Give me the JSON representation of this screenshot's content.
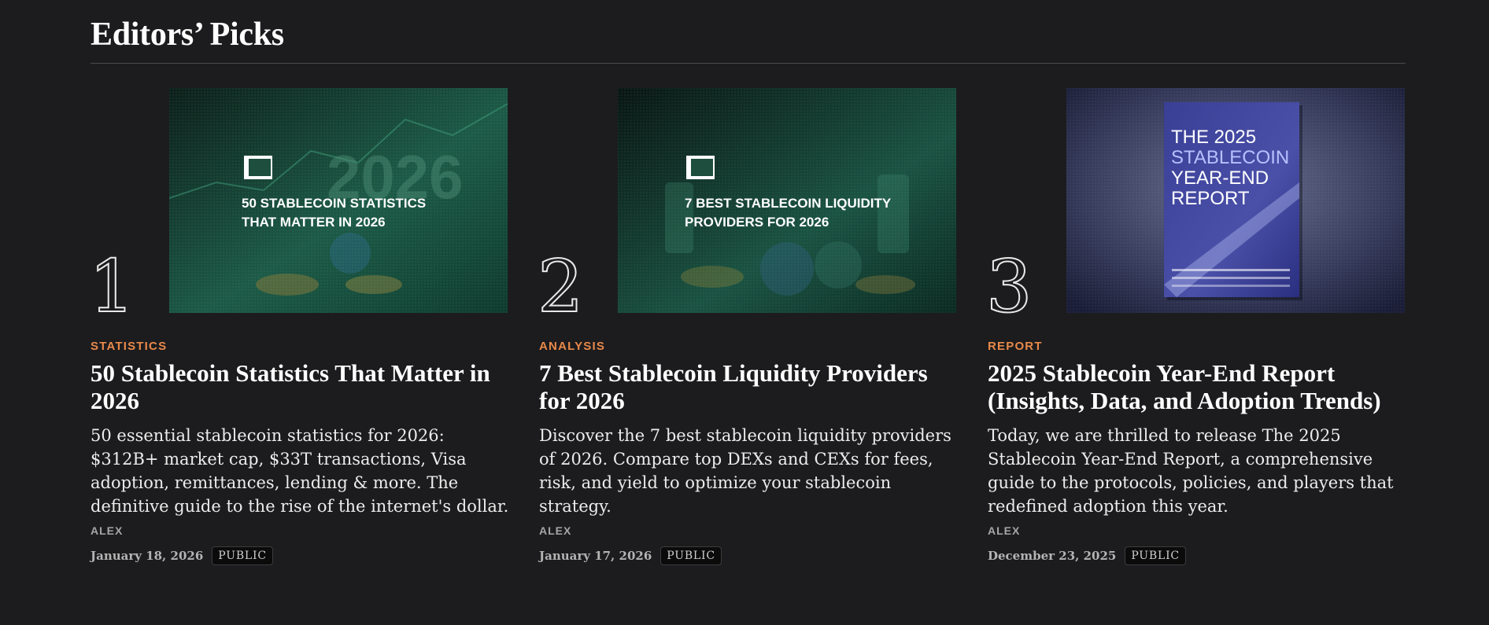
{
  "section": {
    "title": "Editors’ Picks"
  },
  "cards": [
    {
      "rank": "1",
      "category": "STATISTICS",
      "title": "50 Stablecoin Statistics That Matter in 2026",
      "excerpt": "50 essential stablecoin statistics for 2026: $312B+ market cap, $33T transactions, Visa adoption, remittances, lending & more. The definitive guide to the rise of the internet's dollar.",
      "author": "ALEX",
      "date": "January 18, 2026",
      "badge": "PUBLIC",
      "image": {
        "line1": "50 STABLECOIN STATISTICS",
        "line2": "THAT MATTER IN 2026",
        "bg_text": "2026"
      }
    },
    {
      "rank": "2",
      "category": "ANALYSIS",
      "title": "7 Best Stablecoin Liquidity Providers for 2026",
      "excerpt": "Discover the 7 best stablecoin liquidity providers of 2026. Compare top DEXs and CEXs for fees, risk, and yield to optimize your stablecoin strategy.",
      "author": "ALEX",
      "date": "January 17, 2026",
      "badge": "PUBLIC",
      "image": {
        "line1": "7 BEST STABLECOIN LIQUIDITY",
        "line2": "PROVIDERS FOR 2026"
      }
    },
    {
      "rank": "3",
      "category": "REPORT",
      "title": "2025 Stablecoin Year-End Report (Insights, Data, and Adoption Trends)",
      "excerpt": "Today, we are thrilled to release The 2025 Stablecoin Year-End Report, a comprehensive guide to the protocols, policies, and players that redefined adoption this year.",
      "author": "ALEX",
      "date": "December 23, 2025",
      "badge": "PUBLIC",
      "image": {
        "cover_line1": "THE 2025",
        "cover_line2": "STABLECOIN",
        "cover_line3": "YEAR-END",
        "cover_line4": "REPORT"
      }
    }
  ],
  "colors": {
    "category": "#e8894a",
    "background": "#1c1c1e"
  }
}
